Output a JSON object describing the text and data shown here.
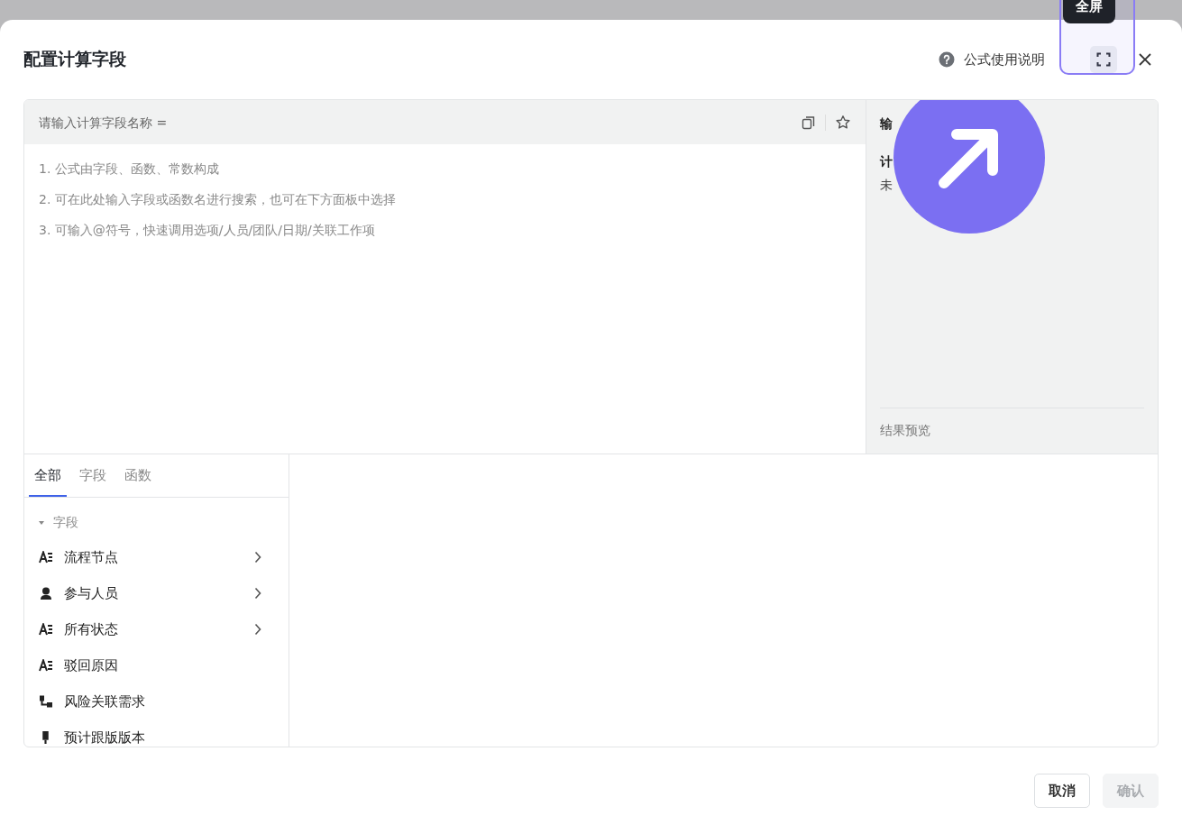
{
  "dialog": {
    "title": "配置计算字段",
    "help_link": "公式使用说明",
    "fullscreen_tooltip": "全屏",
    "fullscreen_highlighted": true
  },
  "editor": {
    "name_placeholder": "请输入计算字段名称 =",
    "hints": [
      "1.  公式由字段、函数、常数构成",
      "2.  可在此处输入字段或函数名进行搜索，也可在下方面板中选择",
      "3.  可输入@符号，快速调用选项/人员/团队/日期/关联工作项"
    ]
  },
  "output_panel": {
    "heading": "输",
    "label": "计",
    "value": "未",
    "preview_label": "结果预览"
  },
  "tabs": [
    {
      "label": "全部",
      "selected": true
    },
    {
      "label": "字段",
      "selected": false
    },
    {
      "label": "函数",
      "selected": false
    }
  ],
  "tree": {
    "label": "字段",
    "expanded": true,
    "children": [
      {
        "label": "流程节点",
        "kind": "text",
        "has_submenu": true
      },
      {
        "label": "参与人员",
        "kind": "person",
        "has_submenu": true
      },
      {
        "label": "所有状态",
        "kind": "text",
        "has_submenu": true
      },
      {
        "label": "驳回原因",
        "kind": "text",
        "has_submenu": false
      },
      {
        "label": "风险关联需求",
        "kind": "link",
        "has_submenu": false
      },
      {
        "label": "预计跟版版本",
        "kind": "tag",
        "has_submenu": false
      }
    ]
  },
  "buttons": [
    {
      "label": "取消",
      "disabled": false
    },
    {
      "label": "确认",
      "disabled": true
    }
  ]
}
